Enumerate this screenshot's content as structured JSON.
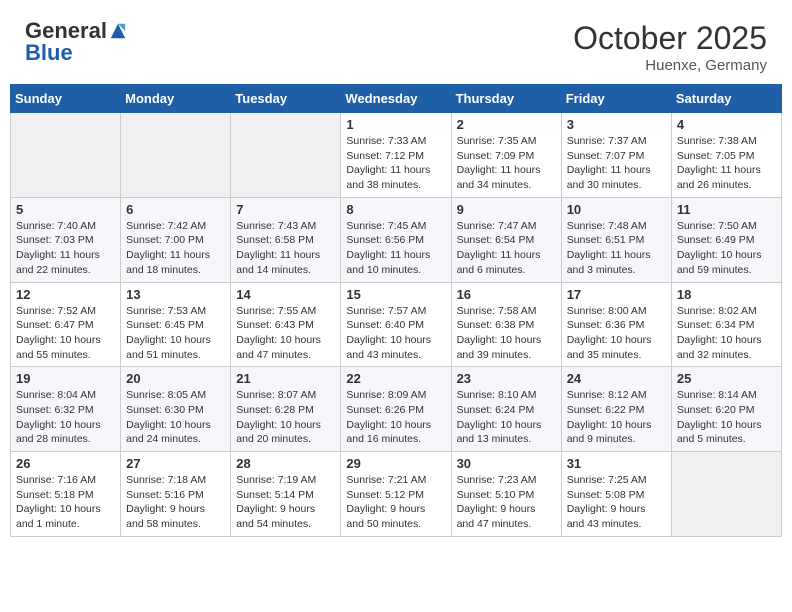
{
  "header": {
    "logo_general": "General",
    "logo_blue": "Blue",
    "month": "October 2025",
    "location": "Huenxe, Germany"
  },
  "days_of_week": [
    "Sunday",
    "Monday",
    "Tuesday",
    "Wednesday",
    "Thursday",
    "Friday",
    "Saturday"
  ],
  "weeks": [
    [
      {
        "day": "",
        "info": ""
      },
      {
        "day": "",
        "info": ""
      },
      {
        "day": "",
        "info": ""
      },
      {
        "day": "1",
        "info": "Sunrise: 7:33 AM\nSunset: 7:12 PM\nDaylight: 11 hours and 38 minutes."
      },
      {
        "day": "2",
        "info": "Sunrise: 7:35 AM\nSunset: 7:09 PM\nDaylight: 11 hours and 34 minutes."
      },
      {
        "day": "3",
        "info": "Sunrise: 7:37 AM\nSunset: 7:07 PM\nDaylight: 11 hours and 30 minutes."
      },
      {
        "day": "4",
        "info": "Sunrise: 7:38 AM\nSunset: 7:05 PM\nDaylight: 11 hours and 26 minutes."
      }
    ],
    [
      {
        "day": "5",
        "info": "Sunrise: 7:40 AM\nSunset: 7:03 PM\nDaylight: 11 hours and 22 minutes."
      },
      {
        "day": "6",
        "info": "Sunrise: 7:42 AM\nSunset: 7:00 PM\nDaylight: 11 hours and 18 minutes."
      },
      {
        "day": "7",
        "info": "Sunrise: 7:43 AM\nSunset: 6:58 PM\nDaylight: 11 hours and 14 minutes."
      },
      {
        "day": "8",
        "info": "Sunrise: 7:45 AM\nSunset: 6:56 PM\nDaylight: 11 hours and 10 minutes."
      },
      {
        "day": "9",
        "info": "Sunrise: 7:47 AM\nSunset: 6:54 PM\nDaylight: 11 hours and 6 minutes."
      },
      {
        "day": "10",
        "info": "Sunrise: 7:48 AM\nSunset: 6:51 PM\nDaylight: 11 hours and 3 minutes."
      },
      {
        "day": "11",
        "info": "Sunrise: 7:50 AM\nSunset: 6:49 PM\nDaylight: 10 hours and 59 minutes."
      }
    ],
    [
      {
        "day": "12",
        "info": "Sunrise: 7:52 AM\nSunset: 6:47 PM\nDaylight: 10 hours and 55 minutes."
      },
      {
        "day": "13",
        "info": "Sunrise: 7:53 AM\nSunset: 6:45 PM\nDaylight: 10 hours and 51 minutes."
      },
      {
        "day": "14",
        "info": "Sunrise: 7:55 AM\nSunset: 6:43 PM\nDaylight: 10 hours and 47 minutes."
      },
      {
        "day": "15",
        "info": "Sunrise: 7:57 AM\nSunset: 6:40 PM\nDaylight: 10 hours and 43 minutes."
      },
      {
        "day": "16",
        "info": "Sunrise: 7:58 AM\nSunset: 6:38 PM\nDaylight: 10 hours and 39 minutes."
      },
      {
        "day": "17",
        "info": "Sunrise: 8:00 AM\nSunset: 6:36 PM\nDaylight: 10 hours and 35 minutes."
      },
      {
        "day": "18",
        "info": "Sunrise: 8:02 AM\nSunset: 6:34 PM\nDaylight: 10 hours and 32 minutes."
      }
    ],
    [
      {
        "day": "19",
        "info": "Sunrise: 8:04 AM\nSunset: 6:32 PM\nDaylight: 10 hours and 28 minutes."
      },
      {
        "day": "20",
        "info": "Sunrise: 8:05 AM\nSunset: 6:30 PM\nDaylight: 10 hours and 24 minutes."
      },
      {
        "day": "21",
        "info": "Sunrise: 8:07 AM\nSunset: 6:28 PM\nDaylight: 10 hours and 20 minutes."
      },
      {
        "day": "22",
        "info": "Sunrise: 8:09 AM\nSunset: 6:26 PM\nDaylight: 10 hours and 16 minutes."
      },
      {
        "day": "23",
        "info": "Sunrise: 8:10 AM\nSunset: 6:24 PM\nDaylight: 10 hours and 13 minutes."
      },
      {
        "day": "24",
        "info": "Sunrise: 8:12 AM\nSunset: 6:22 PM\nDaylight: 10 hours and 9 minutes."
      },
      {
        "day": "25",
        "info": "Sunrise: 8:14 AM\nSunset: 6:20 PM\nDaylight: 10 hours and 5 minutes."
      }
    ],
    [
      {
        "day": "26",
        "info": "Sunrise: 7:16 AM\nSunset: 5:18 PM\nDaylight: 10 hours and 1 minute."
      },
      {
        "day": "27",
        "info": "Sunrise: 7:18 AM\nSunset: 5:16 PM\nDaylight: 9 hours and 58 minutes."
      },
      {
        "day": "28",
        "info": "Sunrise: 7:19 AM\nSunset: 5:14 PM\nDaylight: 9 hours and 54 minutes."
      },
      {
        "day": "29",
        "info": "Sunrise: 7:21 AM\nSunset: 5:12 PM\nDaylight: 9 hours and 50 minutes."
      },
      {
        "day": "30",
        "info": "Sunrise: 7:23 AM\nSunset: 5:10 PM\nDaylight: 9 hours and 47 minutes."
      },
      {
        "day": "31",
        "info": "Sunrise: 7:25 AM\nSunset: 5:08 PM\nDaylight: 9 hours and 43 minutes."
      },
      {
        "day": "",
        "info": ""
      }
    ]
  ]
}
